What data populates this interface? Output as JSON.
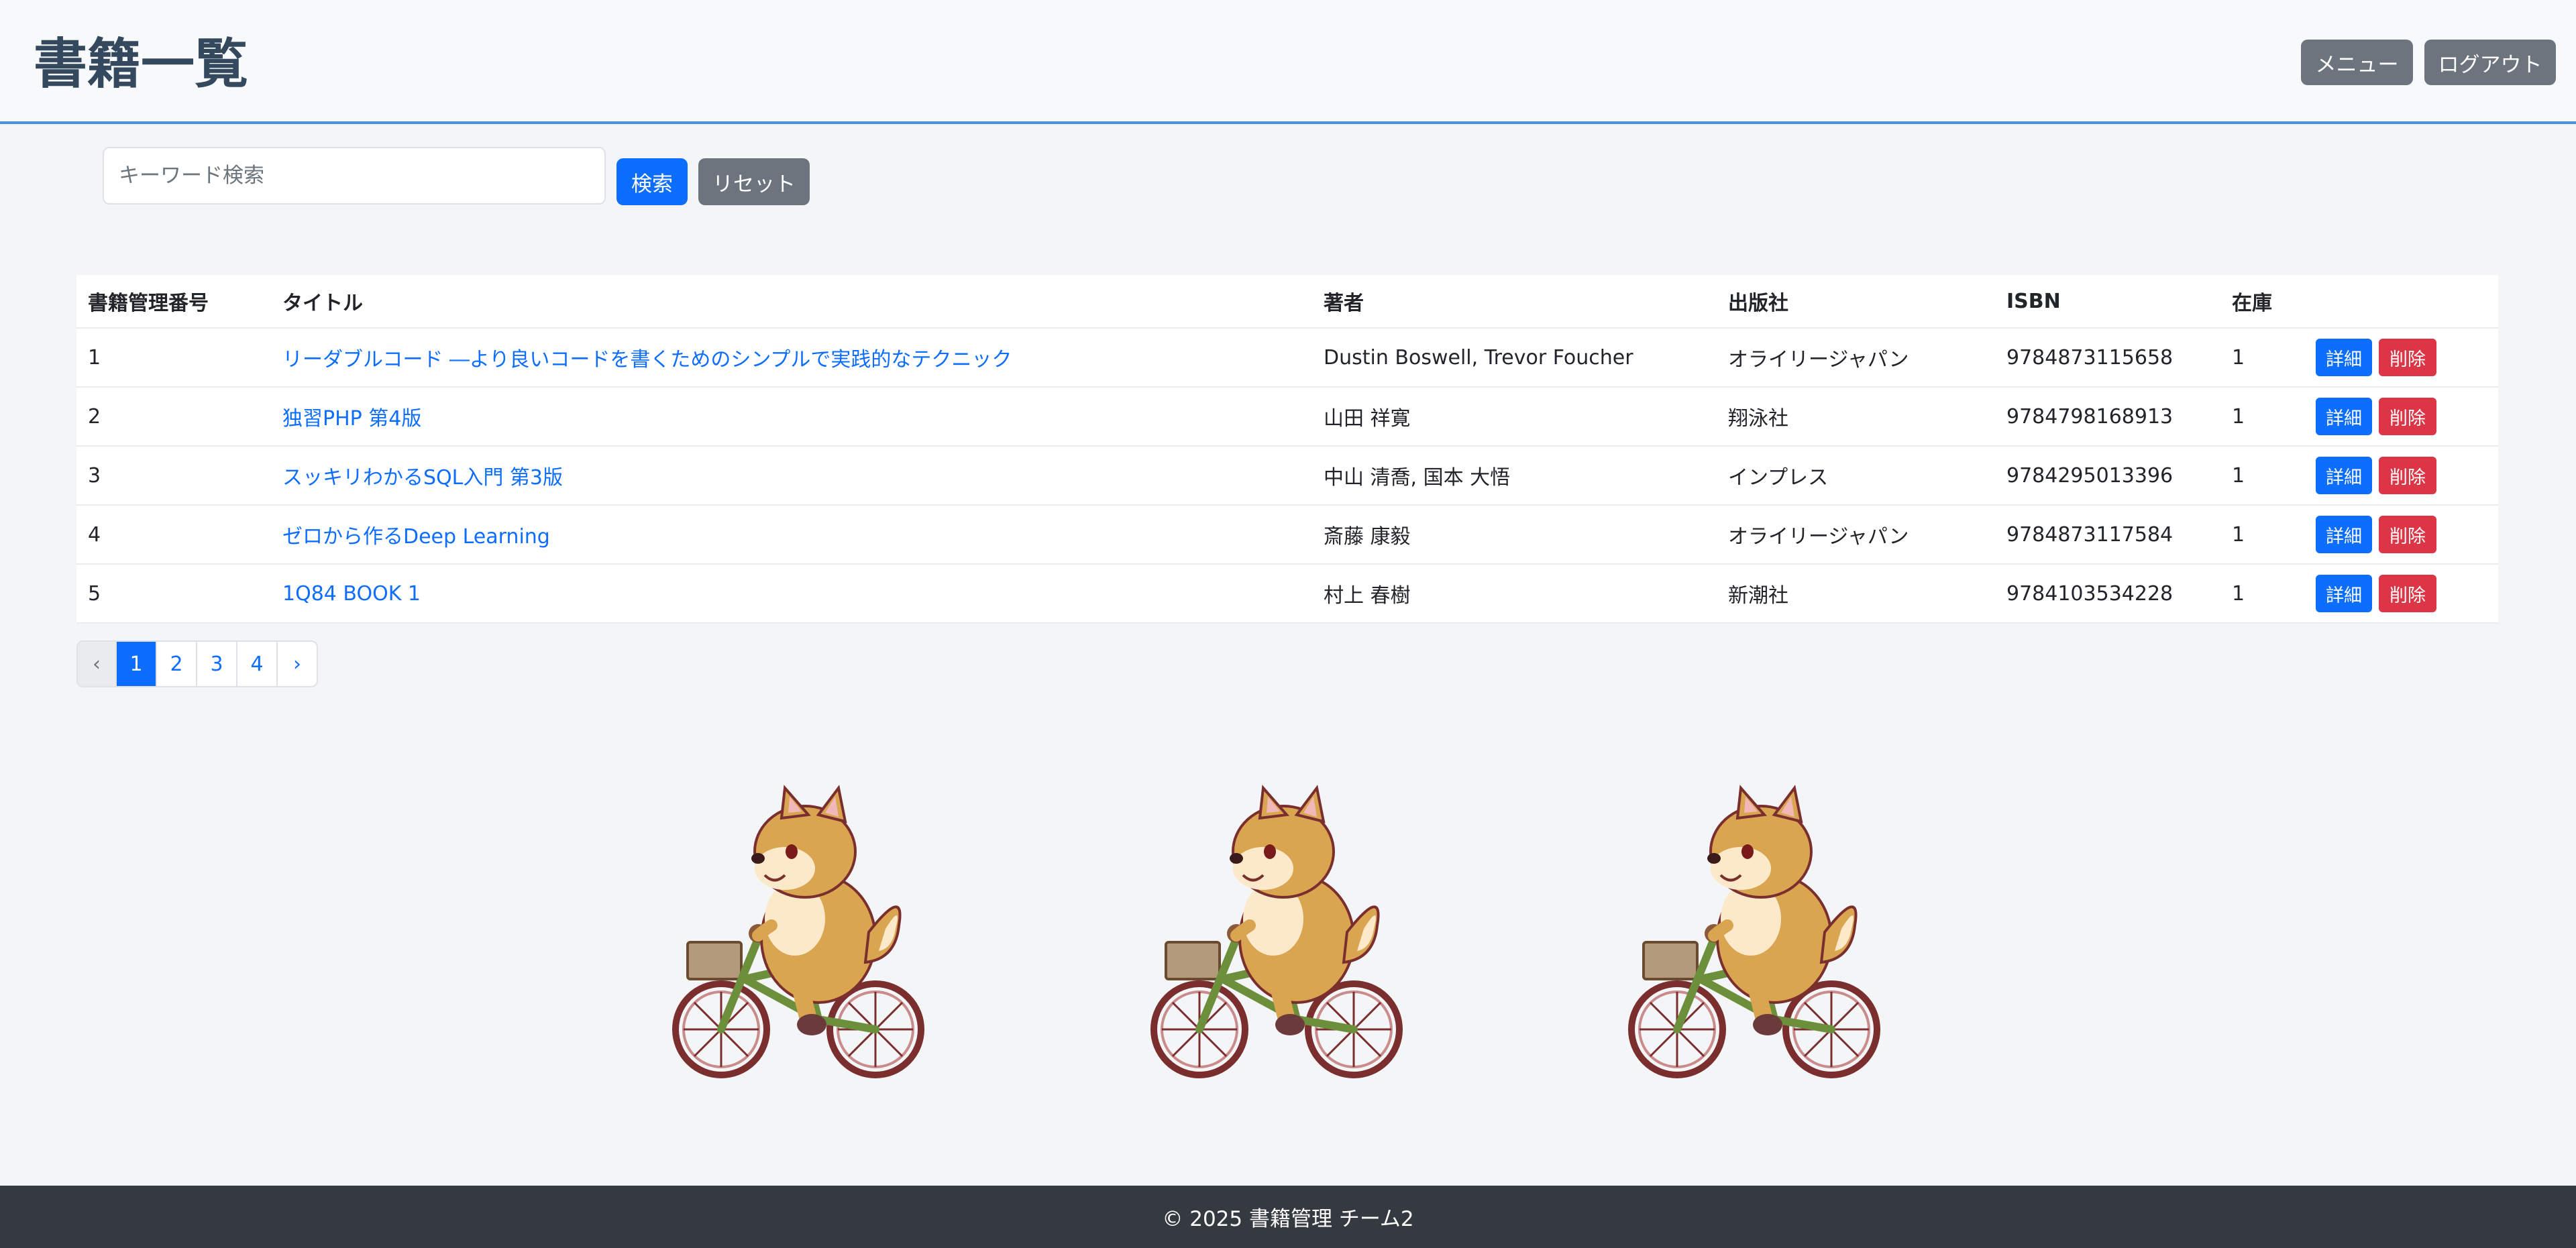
{
  "header": {
    "title": "書籍一覧",
    "menu_label": "メニュー",
    "logout_label": "ログアウト"
  },
  "search": {
    "placeholder": "キーワード検索",
    "value": "",
    "search_label": "検索",
    "reset_label": "リセット"
  },
  "table": {
    "columns": [
      "書籍管理番号",
      "タイトル",
      "著者",
      "出版社",
      "ISBN",
      "在庫"
    ],
    "rows": [
      {
        "id": "1",
        "title": "リーダブルコード ―より良いコードを書くためのシンプルで実践的なテクニック",
        "author": "Dustin Boswell, Trevor Foucher",
        "publisher": "オライリージャパン",
        "isbn": "9784873115658",
        "stock": "1"
      },
      {
        "id": "2",
        "title": "独習PHP 第4版",
        "author": "山田 祥寛",
        "publisher": "翔泳社",
        "isbn": "9784798168913",
        "stock": "1"
      },
      {
        "id": "3",
        "title": "スッキリわかるSQL入門 第3版",
        "author": "中山 清喬, 国本 大悟",
        "publisher": "インプレス",
        "isbn": "9784295013396",
        "stock": "1"
      },
      {
        "id": "4",
        "title": "ゼロから作るDeep Learning",
        "author": "斎藤 康毅",
        "publisher": "オライリージャパン",
        "isbn": "9784873117584",
        "stock": "1"
      },
      {
        "id": "5",
        "title": "1Q84 BOOK 1",
        "author": "村上 春樹",
        "publisher": "新潮社",
        "isbn": "9784103534228",
        "stock": "1"
      }
    ],
    "detail_label": "詳細",
    "delete_label": "削除"
  },
  "pagination": {
    "prev": "‹",
    "pages": [
      "1",
      "2",
      "3",
      "4"
    ],
    "next": "›",
    "current": "1"
  },
  "illustrations": {
    "icon": "shiba-dog-riding-bicycle"
  },
  "footer": {
    "text": "© 2025 書籍管理 チーム2"
  },
  "colors": {
    "primary": "#0d6efd",
    "danger": "#dc3545",
    "secondary": "#6c757d",
    "header_border": "#4a90e2",
    "footer_bg": "#343a40"
  }
}
